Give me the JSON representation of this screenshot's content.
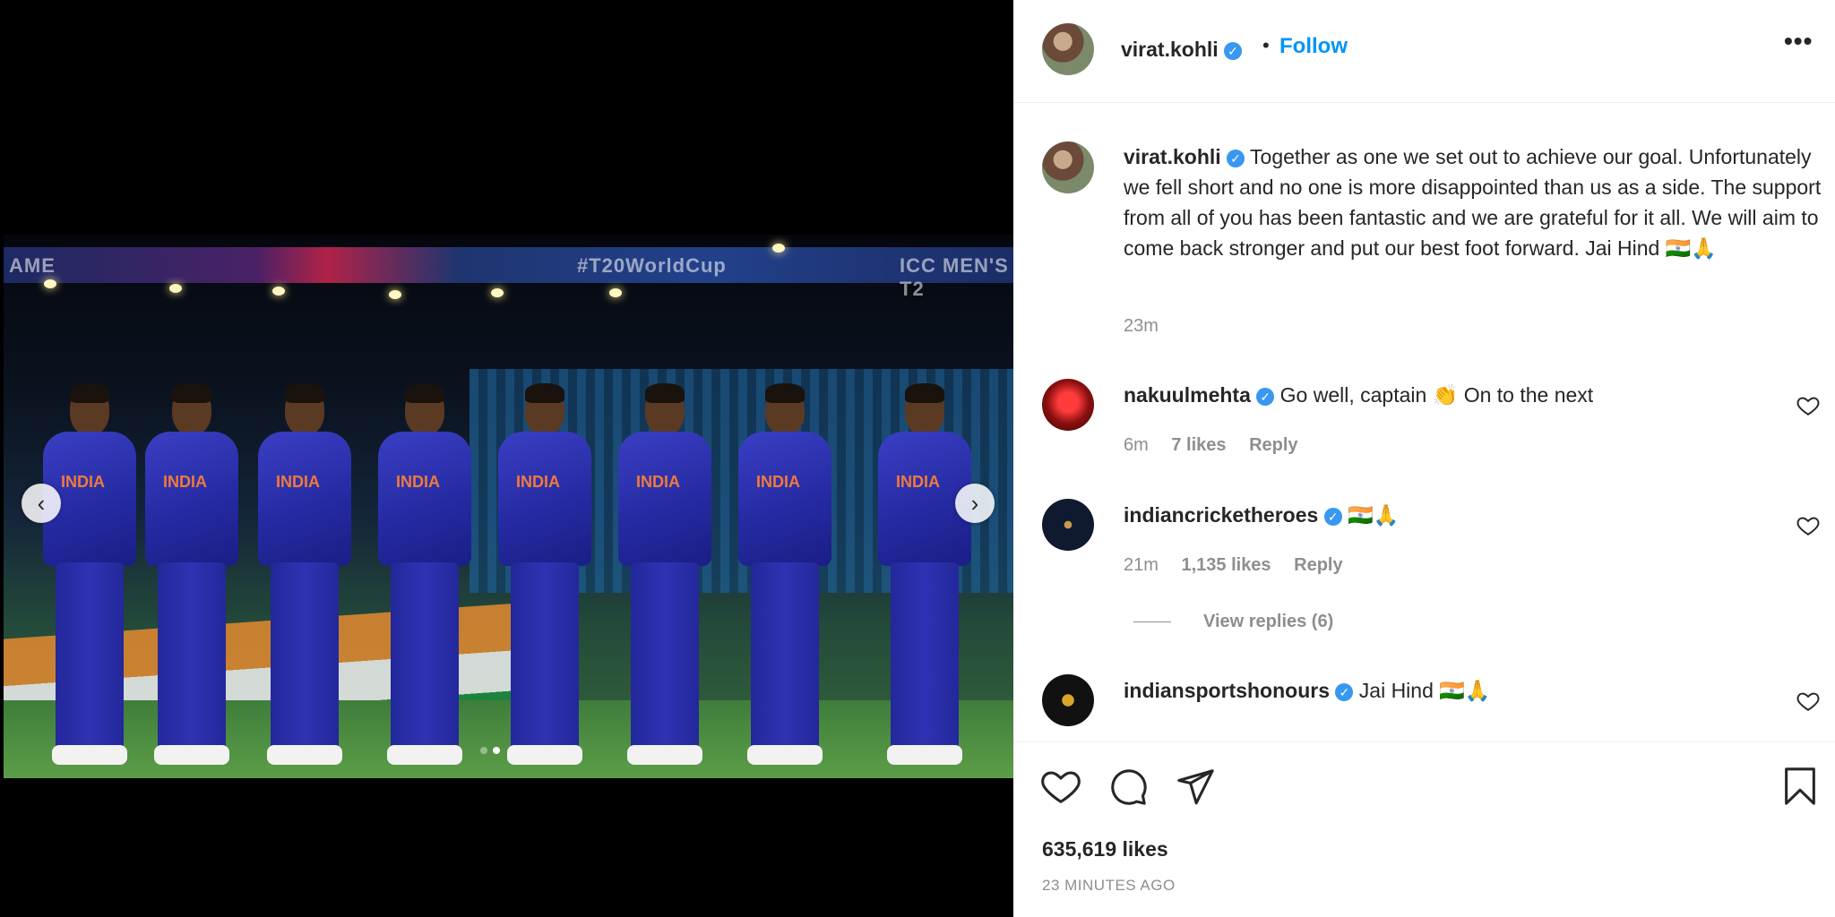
{
  "media": {
    "band_left": "AME",
    "band_hashtag": "#T20WorldCup",
    "band_right": "ICC MEN'S T2",
    "jersey_text": "INDIA",
    "prev_arrow": "‹",
    "next_arrow": "›"
  },
  "header": {
    "username": "virat.kohli",
    "verified": "✓",
    "separator": "•",
    "follow_label": "Follow",
    "more_label": "•••"
  },
  "caption": {
    "username": "virat.kohli",
    "text": "Together as one we set out to achieve our goal. Unfortunately we fell short and no one is more disappointed than us as a side. The support from all of you has been fantastic and we are grateful for it all. We will aim to come back stronger and put our best foot forward. Jai Hind 🇮🇳🙏",
    "time": "23m"
  },
  "comments": [
    {
      "username": "nakuulmehta",
      "text": "Go well, captain 👏 On to the next",
      "time": "6m",
      "likes": "7 likes",
      "reply": "Reply"
    },
    {
      "username": "indiancricketheroes",
      "text": "🇮🇳🙏",
      "time": "21m",
      "likes": "1,135 likes",
      "reply": "Reply",
      "view_replies": "View replies (6)"
    },
    {
      "username": "indiansportshonours",
      "text": "Jai Hind 🇮🇳🙏"
    }
  ],
  "footer": {
    "likes": "635,619 likes",
    "time": "23 MINUTES AGO"
  },
  "icons": {
    "like": "heart-icon",
    "comment": "comment-icon",
    "share": "share-icon",
    "save": "bookmark-icon"
  },
  "colors": {
    "link_blue": "#0095f6",
    "verified_blue": "#3897f0",
    "muted": "#8e8e8e"
  }
}
